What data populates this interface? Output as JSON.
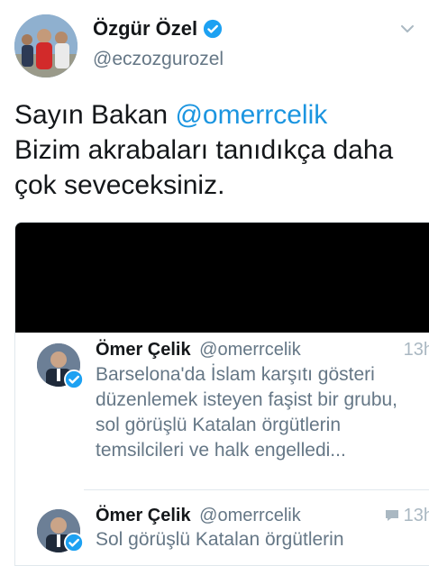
{
  "tweet": {
    "author_name": "Özgür Özel",
    "author_handle": "@eczozgurozel",
    "text_before": "Sayın Bakan ",
    "mention": "@omerrcelik",
    "text_after": "Bizim akrabaları tanıdıkça daha çok seveceksiniz.",
    "icons": [
      "verified-badge-icon",
      "chevron-down-icon"
    ],
    "accent_color": "#1b95e0"
  },
  "quoted": [
    {
      "name": "Ömer Çelik",
      "handle": "@omerrcelik",
      "time": "13h",
      "text": "Barselona'da İslam karşıtı gösteri düzenlemek isteyen faşist bir grubu, sol görüşlü Katalan örgütlerin temsilcileri ve halk engelledi..."
    },
    {
      "name": "Ömer Çelik",
      "handle": "@omerrcelik",
      "time": "13h",
      "text": "Sol görüşlü Katalan örgütlerin"
    }
  ]
}
